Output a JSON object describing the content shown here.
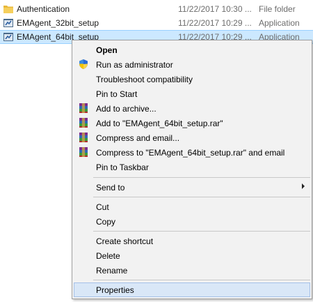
{
  "files": [
    {
      "name": "Authentication",
      "date": "11/22/2017 10:30 ...",
      "type": "File folder",
      "icon": "folder-icon"
    },
    {
      "name": "EMAgent_32bit_setup",
      "date": "11/22/2017 10:29 ...",
      "type": "Application",
      "icon": "installer-icon"
    },
    {
      "name": "EMAgent_64bit_setup",
      "date": "11/22/2017 10:29 ...",
      "type": "Application",
      "icon": "installer-icon"
    }
  ],
  "menu": {
    "open": "Open",
    "run_as_admin": "Run as administrator",
    "troubleshoot": "Troubleshoot compatibility",
    "pin_start": "Pin to Start",
    "add_archive": "Add to archive...",
    "add_rar": "Add to \"EMAgent_64bit_setup.rar\"",
    "compress_email": "Compress and email...",
    "compress_rar_email": "Compress to \"EMAgent_64bit_setup.rar\" and email",
    "pin_taskbar": "Pin to Taskbar",
    "send_to": "Send to",
    "cut": "Cut",
    "copy": "Copy",
    "create_shortcut": "Create shortcut",
    "delete": "Delete",
    "rename": "Rename",
    "properties": "Properties"
  },
  "colors": {
    "selection": "#cce8ff",
    "menu_background": "#f2f2f2",
    "menu_hover": "#d9e7f7"
  }
}
